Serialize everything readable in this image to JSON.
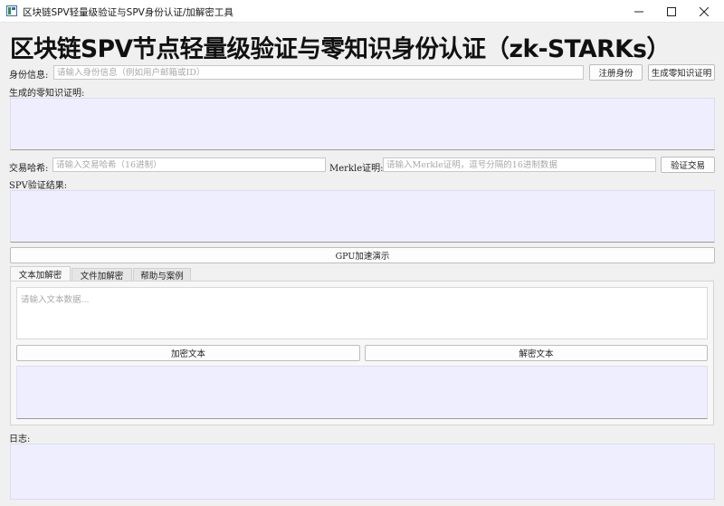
{
  "window": {
    "title": "区块链SPV轻量级验证与SPV身份认证/加解密工具",
    "controls": [
      "minimize-icon",
      "maximize-icon",
      "close-icon"
    ]
  },
  "headline": "区块链SPV节点轻量级验证与零知识身份认证（zk-STARKs）",
  "identity": {
    "label": "身份信息:",
    "placeholder": "请输入身份信息（例如用户邮箱或ID）",
    "value": "",
    "register_button": "注册身份",
    "generate_button": "生成零知识证明"
  },
  "zk_proof": {
    "label": "生成的零知识证明:",
    "value": ""
  },
  "transaction": {
    "hash_label": "交易哈希:",
    "hash_placeholder": "请输入交易哈希（16进制）",
    "merkle_label": "Merkle证明:",
    "merkle_placeholder": "请输入Merkle证明，逗号分隔的16进制数据",
    "verify_button": "验证交易"
  },
  "spv_result": {
    "label": "SPV验证结果:",
    "value": ""
  },
  "gpu_button": "GPU加速演示",
  "tabs": [
    {
      "label": "文本加解密",
      "active": true
    },
    {
      "label": "文件加解密",
      "active": false
    },
    {
      "label": "帮助与案例",
      "active": false
    }
  ],
  "text_crypto": {
    "input_placeholder": "请输入文本数据...",
    "encrypt_button": "加密文本",
    "decrypt_button": "解密文本",
    "output_value": ""
  },
  "log": {
    "label": "日志:",
    "value": ""
  },
  "colors": {
    "output_area_bg": "#efeefe",
    "window_bg": "#f0f0f0"
  }
}
